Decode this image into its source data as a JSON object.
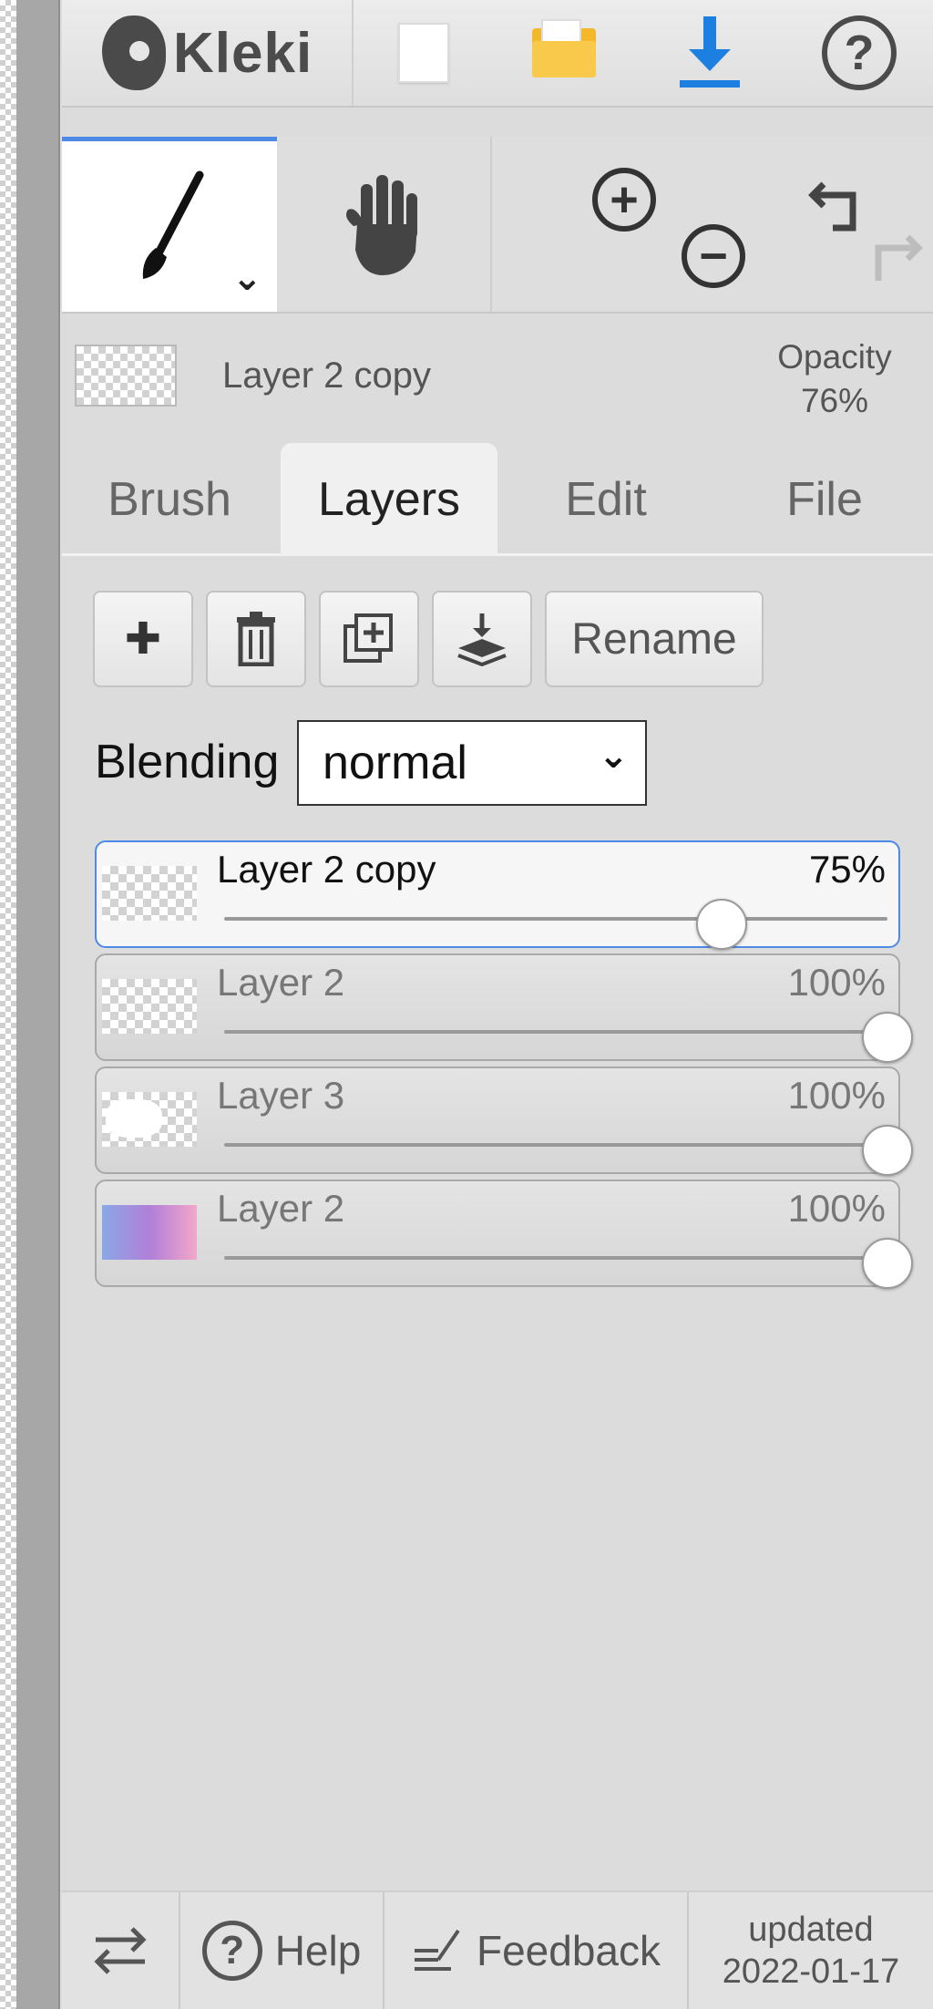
{
  "app": {
    "name": "Kleki"
  },
  "info": {
    "layer_name": "Layer 2 copy",
    "opacity_label": "Opacity",
    "opacity_value": "76%"
  },
  "tabs": [
    {
      "label": "Brush",
      "active": false
    },
    {
      "label": "Layers",
      "active": true
    },
    {
      "label": "Edit",
      "active": false
    },
    {
      "label": "File",
      "active": false
    }
  ],
  "actions": {
    "add": "✚",
    "rename": "Rename"
  },
  "blending": {
    "label": "Blending",
    "value": "normal"
  },
  "layers": [
    {
      "name": "Layer 2 copy",
      "opacity_label": "75%",
      "opacity": 0.75,
      "selected": true,
      "thumb": "checker-pink"
    },
    {
      "name": "Layer 2",
      "opacity_label": "100%",
      "opacity": 1.0,
      "selected": false,
      "thumb": "checker-pink"
    },
    {
      "name": "Layer 3",
      "opacity_label": "100%",
      "opacity": 1.0,
      "selected": false,
      "thumb": "white-cloud"
    },
    {
      "name": "Layer 2",
      "opacity_label": "100%",
      "opacity": 1.0,
      "selected": false,
      "thumb": "pastel-gradient"
    }
  ],
  "footer": {
    "help": "Help",
    "feedback": "Feedback",
    "updated_label": "updated",
    "updated_date": "2022-01-17"
  },
  "colors": {
    "accent": "#4d8ae8",
    "download": "#1d7fe0",
    "folder": "#f4b82c"
  }
}
